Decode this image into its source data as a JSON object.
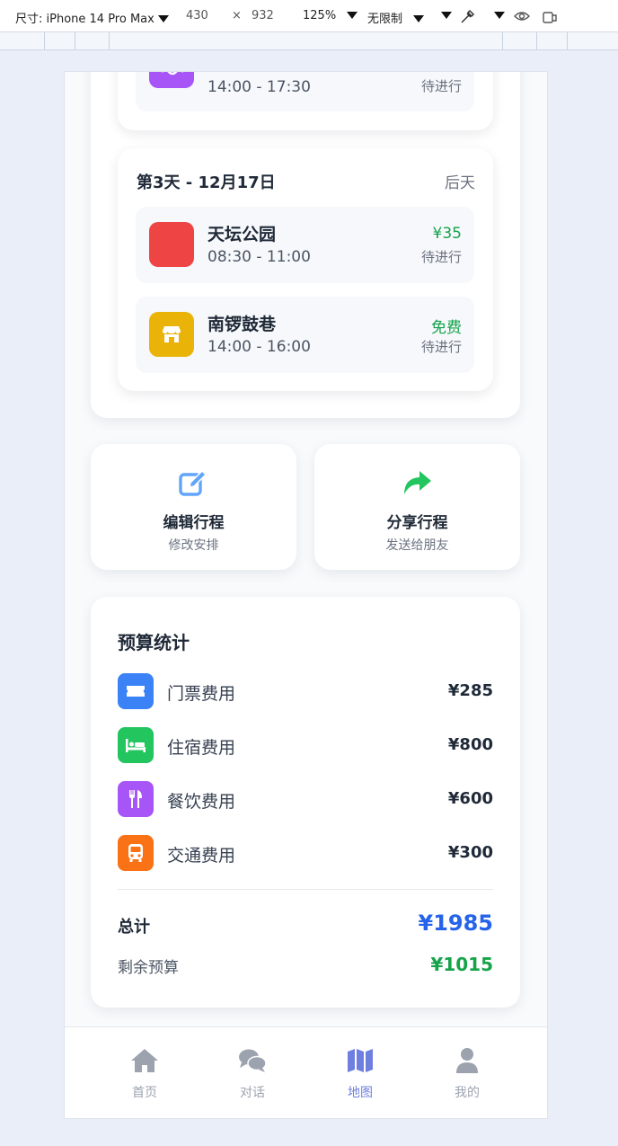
{
  "devtools": {
    "device_label": "尺寸: iPhone 14 Pro Max",
    "width": "430",
    "times": "×",
    "height": "932",
    "zoom": "125%",
    "throttle": "无限制"
  },
  "itinerary": {
    "prev_item": {
      "time": "14:00 - 17:30",
      "status": "待进行",
      "icon": "water-waves-icon",
      "color": "#a855f7"
    },
    "day3": {
      "title": "第3天 - 12月17日",
      "relative": "后天",
      "activities": [
        {
          "name": "天坛公园",
          "time": "08:30 - 11:00",
          "price": "¥35",
          "status": "待进行",
          "icon": "red-square-icon",
          "color": "#ef4444"
        },
        {
          "name": "南锣鼓巷",
          "time": "14:00 - 16:00",
          "price": "免费",
          "status": "待进行",
          "icon": "store-icon",
          "color": "#eab308"
        }
      ]
    }
  },
  "actions": {
    "edit": {
      "label": "编辑行程",
      "sub": "修改安排",
      "icon": "edit-icon",
      "color": "#60a5fa"
    },
    "share": {
      "label": "分享行程",
      "sub": "发送给朋友",
      "icon": "share-icon",
      "color": "#22c55e"
    }
  },
  "budget": {
    "title": "预算统计",
    "items": [
      {
        "label": "门票费用",
        "amount": "¥285",
        "icon": "ticket-icon",
        "color": "#3b82f6"
      },
      {
        "label": "住宿费用",
        "amount": "¥800",
        "icon": "bed-icon",
        "color": "#22c55e"
      },
      {
        "label": "餐饮费用",
        "amount": "¥600",
        "icon": "utensils-icon",
        "color": "#a855f7"
      },
      {
        "label": "交通费用",
        "amount": "¥300",
        "icon": "bus-icon",
        "color": "#f97316"
      }
    ],
    "total_label": "总计",
    "total_value": "¥1985",
    "remaining_label": "剩余预算",
    "remaining_value": "¥1015"
  },
  "tabbar": {
    "items": [
      {
        "label": "首页",
        "icon": "home-icon"
      },
      {
        "label": "对话",
        "icon": "chat-icon"
      },
      {
        "label": "地图",
        "icon": "map-icon",
        "active": true
      },
      {
        "label": "我的",
        "icon": "user-icon"
      }
    ]
  }
}
